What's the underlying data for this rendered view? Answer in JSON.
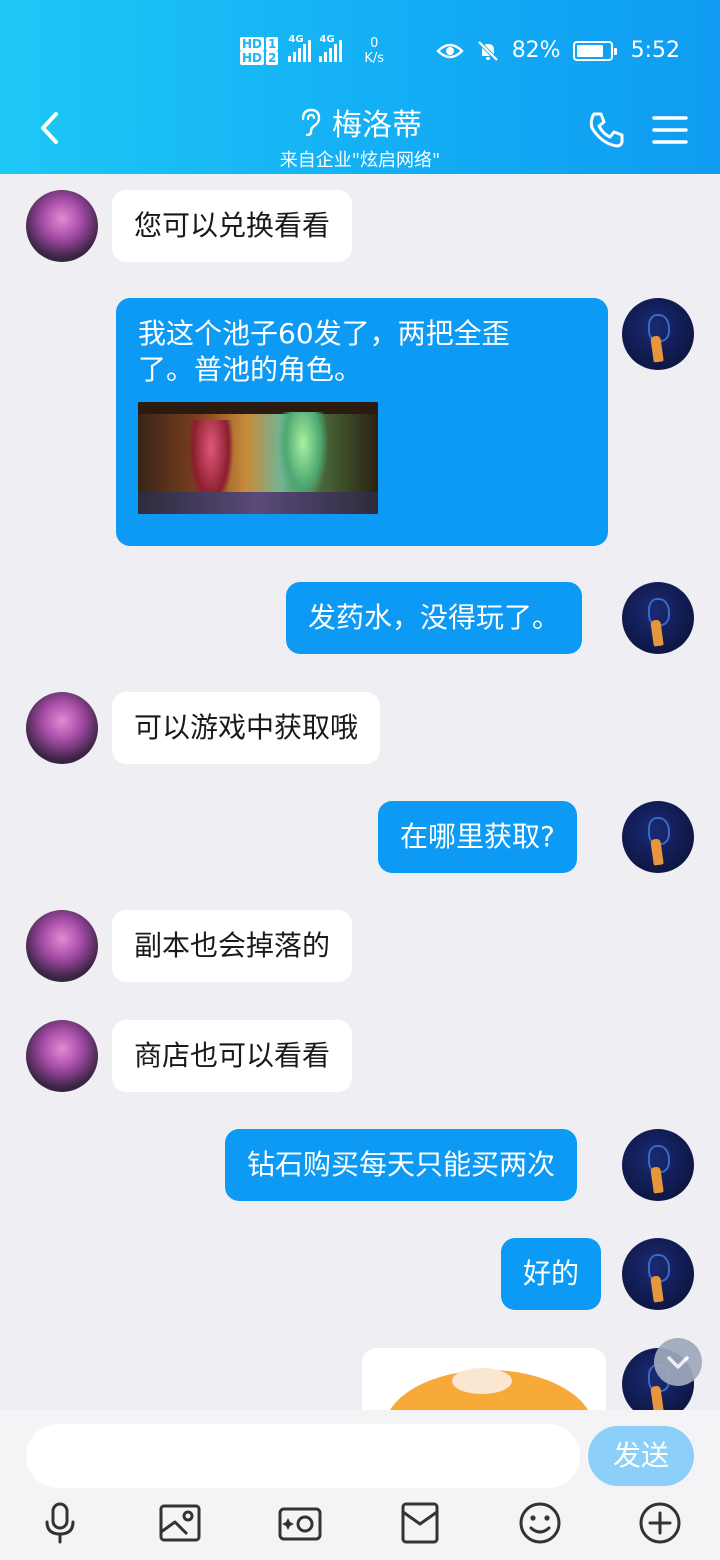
{
  "status_bar": {
    "hd1": "HD",
    "hd1_num": "1",
    "hd2": "HD",
    "hd2_num": "2",
    "net1": "4G",
    "net2": "4G",
    "speed_value": "0",
    "speed_unit": "K/s",
    "battery": "82%",
    "battery_level": 0.82,
    "time": "5:52"
  },
  "header": {
    "title": "梅洛蒂",
    "subtitle": "来自企业\"炫启网络\"",
    "title_icon": "ear-icon"
  },
  "messages": [
    {
      "side": "in",
      "text": "您可以兑换看看"
    },
    {
      "side": "out",
      "text": "我这个池子60发了，两把全歪了。普池的角色。",
      "line1": "我这个池子60发了，两把全歪",
      "line2": "了。普池的角色。",
      "has_image": true
    },
    {
      "side": "out",
      "text": "发药水，没得玩了。"
    },
    {
      "side": "in",
      "text": "可以游戏中获取哦"
    },
    {
      "side": "out",
      "text": "在哪里获取?"
    },
    {
      "side": "in",
      "text": "副本也会掉落的"
    },
    {
      "side": "in",
      "text": "商店也可以看看"
    },
    {
      "side": "out",
      "text": "钻石购买每天只能买两次"
    },
    {
      "side": "out",
      "text": "好的"
    },
    {
      "side": "out",
      "sticker": "fox-sticker"
    }
  ],
  "input": {
    "placeholder": "",
    "value": "",
    "send_label": "发送"
  },
  "toolbar": [
    "microphone-icon",
    "image-icon",
    "camera-icon",
    "red-packet-icon",
    "emoji-icon",
    "plus-icon"
  ],
  "colors": {
    "header_start": "#1ec8f6",
    "header_end": "#0f9cf2",
    "bubble_out": "#0d9af5",
    "bubble_in": "#ffffff",
    "background": "#efeff3",
    "send_button": "#8ccff8"
  }
}
